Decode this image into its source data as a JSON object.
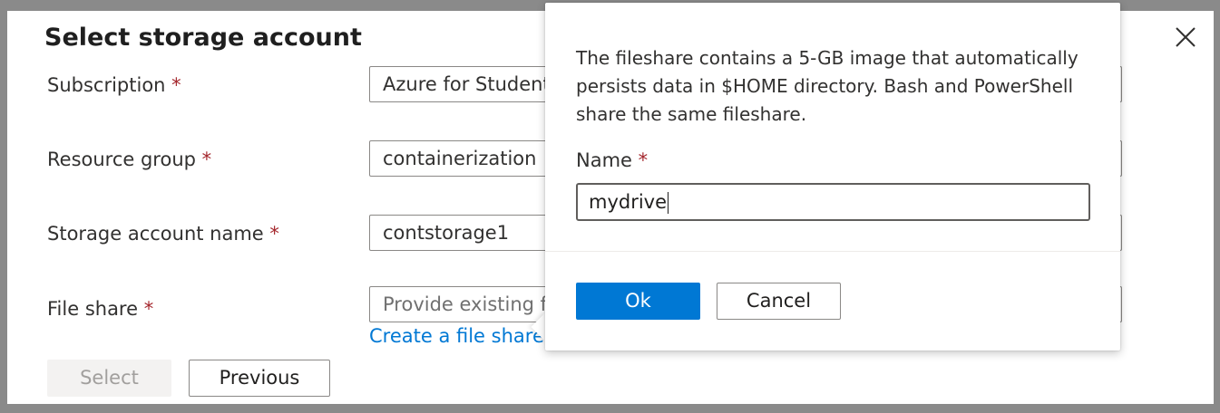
{
  "dialog": {
    "title": "Select storage account",
    "close_icon": "close-icon"
  },
  "form": {
    "subscription": {
      "label": "Subscription",
      "required_mark": "*",
      "value": "Azure for Students"
    },
    "resource_group": {
      "label": "Resource group",
      "required_mark": "*",
      "value": "containerization"
    },
    "storage_account_name": {
      "label": "Storage account name",
      "required_mark": "*",
      "value": "contstorage1"
    },
    "file_share": {
      "label": "File share",
      "required_mark": "*",
      "placeholder": "Provide existing fil"
    },
    "create_link": "Create a file share"
  },
  "buttons": {
    "select": "Select",
    "previous": "Previous"
  },
  "callout": {
    "description": "The fileshare contains a 5-GB image that automatically persists data in $HOME directory. Bash and PowerShell share the same fileshare.",
    "name_label": "Name",
    "name_required_mark": "*",
    "name_value": "mydrive",
    "ok_label": "Ok",
    "cancel_label": "Cancel"
  },
  "colors": {
    "primary": "#0078d4",
    "required": "#a4262c",
    "overlay": "#8a8a8a"
  }
}
